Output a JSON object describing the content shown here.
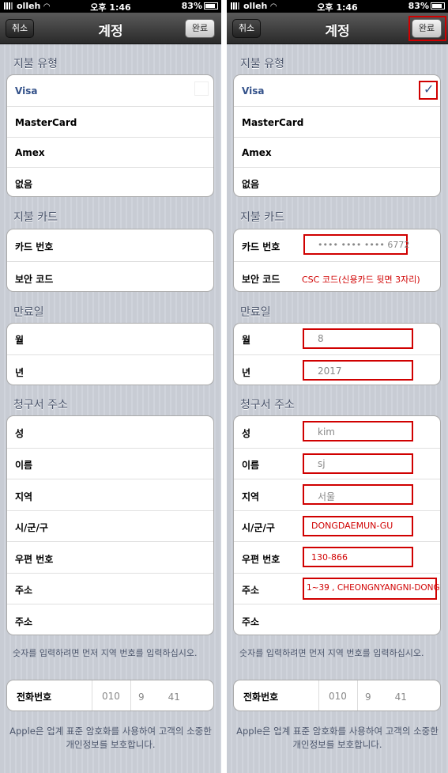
{
  "status": {
    "carrier": "olleh",
    "time": "오후 1:46",
    "battery": "83%"
  },
  "nav": {
    "title": "계정",
    "cancel": "취소",
    "done": "완료"
  },
  "payment_type": {
    "title": "지불 유형",
    "options": [
      "Visa",
      "MasterCard",
      "Amex",
      "없음"
    ]
  },
  "payment_card": {
    "title": "지불 카드",
    "card_number_label": "카드 번호",
    "security_code_label": "보안 코드",
    "card_number_value": "•••• •••• •••• 6772",
    "security_code_note": "CSC 코드(신용카드 뒷면 3자리)"
  },
  "expiry": {
    "title": "만료일",
    "month_label": "월",
    "year_label": "년",
    "month_value": "8",
    "year_value": "2017"
  },
  "billing": {
    "title": "청구서 주소",
    "labels": [
      "성",
      "이름",
      "지역",
      "시/군/구",
      "우편 번호",
      "주소",
      "주소"
    ],
    "values": [
      "kim",
      "sj",
      "서울",
      "DONGDAEMUN-GU",
      "130-866",
      "1~39 , CHEONGNYANGNI-DONG",
      ""
    ]
  },
  "note": "숫자를 입력하려면 먼저 지역 번호를 입력하십시오.",
  "phone": {
    "label": "전화번호",
    "area": "010",
    "number_start": "9",
    "number_end": "41"
  },
  "footer": "Apple은 업계 표준 암호화를 사용하여 고객의 소중한 개인정보를 보호합니다.",
  "colors": {
    "highlight": "#d00000",
    "accent": "#34528a"
  },
  "icons": {
    "check": "checkmark-icon",
    "signal": "signal-icon",
    "wifi": "wifi-icon",
    "battery": "battery-icon"
  }
}
